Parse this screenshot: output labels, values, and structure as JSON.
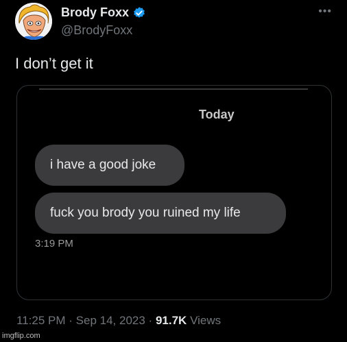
{
  "tweet": {
    "display_name": "Brody Foxx",
    "handle": "@BrodyFoxx",
    "text": "I don’t get it",
    "time": "11:25 PM",
    "separator1": "·",
    "date": "Sep 14, 2023",
    "separator2": "·",
    "views_count": "91.7K",
    "views_label": "Views"
  },
  "media": {
    "day_label": "Today",
    "messages": [
      "i have a good joke",
      "fuck you brody you ruined my life"
    ],
    "message_time": "3:19 PM"
  },
  "icons": {
    "verified": "verified-badge-icon",
    "more": "more-options-icon"
  },
  "colors": {
    "background": "#000000",
    "verified_blue": "#1d9bf0",
    "bubble": "#3b3b3d",
    "muted_text": "#71767b"
  },
  "watermark": "imgflip.com"
}
